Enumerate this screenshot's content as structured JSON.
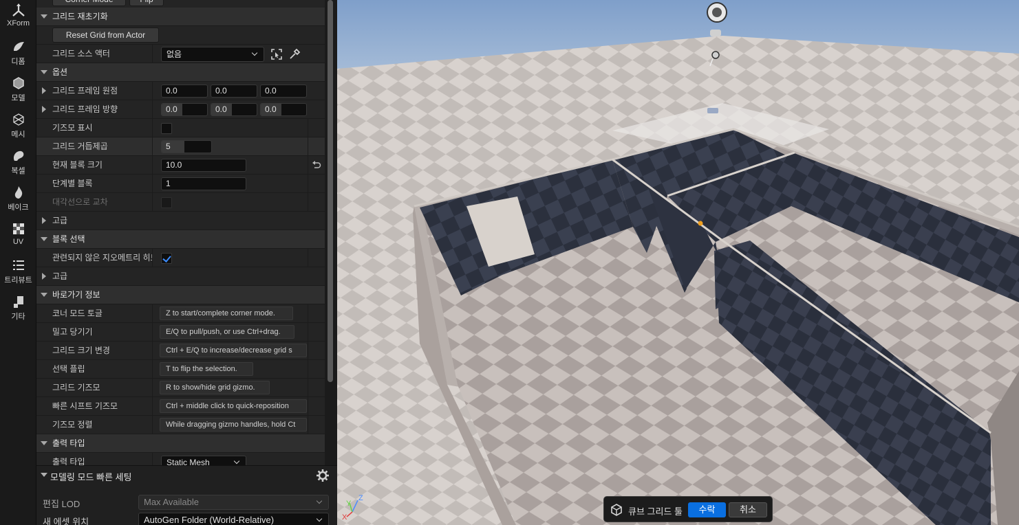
{
  "toolstrip": [
    {
      "label": "XForm",
      "icon": "xform-icon"
    },
    {
      "label": "디폼",
      "icon": "deform-icon"
    },
    {
      "label": "모델",
      "icon": "model-icon"
    },
    {
      "label": "메시",
      "icon": "mesh-icon"
    },
    {
      "label": "복셀",
      "icon": "voxel-icon"
    },
    {
      "label": "베이크",
      "icon": "bake-icon"
    },
    {
      "label": "UV",
      "icon": "uv-icon"
    },
    {
      "label": "트리뷰트",
      "icon": "attributes-icon"
    },
    {
      "label": "기타",
      "icon": "misc-icon"
    }
  ],
  "top_buttons": {
    "corner_mode": "Corner Mode",
    "flip": "Flip"
  },
  "sections": {
    "grid_reset": "그리드 재초기화",
    "options": "옵션",
    "advanced1": "고급",
    "block_select": "블록 선택",
    "advanced2": "고급",
    "shortcuts": "바로가기 정보",
    "output_type": "출력 타입"
  },
  "grid_reset": {
    "reset_button": "Reset Grid from Actor",
    "source_actor_label": "그리드 소스 액터",
    "source_actor_value": "없음"
  },
  "options": {
    "frame_origin_label": "그리드 프레임 원점",
    "frame_origin": [
      "0.0",
      "0.0",
      "0.0"
    ],
    "frame_orientation_label": "그리드 프레임 방향",
    "frame_orientation": [
      "0.0",
      "0.0",
      "0.0"
    ],
    "show_gizmo_label": "기즈모 표시",
    "show_gizmo": false,
    "grid_power_label": "그리드 거듭제곱",
    "grid_power": "5",
    "grid_power_fill": 0.45,
    "current_block_size_label": "현재 블록 크기",
    "current_block_size": "10.0",
    "blocks_per_step_label": "단계별 블록",
    "blocks_per_step": "1",
    "cross_diagonal_label": "대각선으로 교차",
    "cross_diagonal": false
  },
  "block_select": {
    "hit_unrelated_label": "관련되지 않은 지오메트리 히트",
    "hit_unrelated": true
  },
  "shortcuts": [
    {
      "label": "코너 모드 토글",
      "hint": "Z to start/complete corner mode."
    },
    {
      "label": "밀고 당기기",
      "hint": "E/Q to pull/push, or use Ctrl+drag."
    },
    {
      "label": "그리드 크기 변경",
      "hint": "Ctrl + E/Q to increase/decrease grid s"
    },
    {
      "label": "선택 플립",
      "hint": "T to flip the selection."
    },
    {
      "label": "그리드 기즈모",
      "hint": "R to show/hide grid gizmo."
    },
    {
      "label": "빠른 시프트 기즈모",
      "hint": "Ctrl + middle click to quick-reposition"
    },
    {
      "label": "기즈모 정렬",
      "hint": "While dragging gizmo handles, hold Ct"
    }
  ],
  "output": {
    "label": "출력 타입",
    "value": "Static Mesh"
  },
  "quick_settings": {
    "title": "모델링 모드 빠른 세팅",
    "edit_lod_label": "편집 LOD",
    "edit_lod_value": "Max Available",
    "asset_location_label": "새 에셋 위치",
    "asset_location_value": "AutoGen Folder (World-Relative)"
  },
  "viewport_toolbar": {
    "tool_name": "큐브 그리드 툴",
    "accept": "수락",
    "cancel": "취소"
  },
  "axis": {
    "z": "Z",
    "y": "Y",
    "x": "X"
  },
  "colors": {
    "accent": "#0a6fe0",
    "check": "#3b8cff",
    "sky": "#8aa7cc",
    "wall": "#2a2e3a"
  }
}
